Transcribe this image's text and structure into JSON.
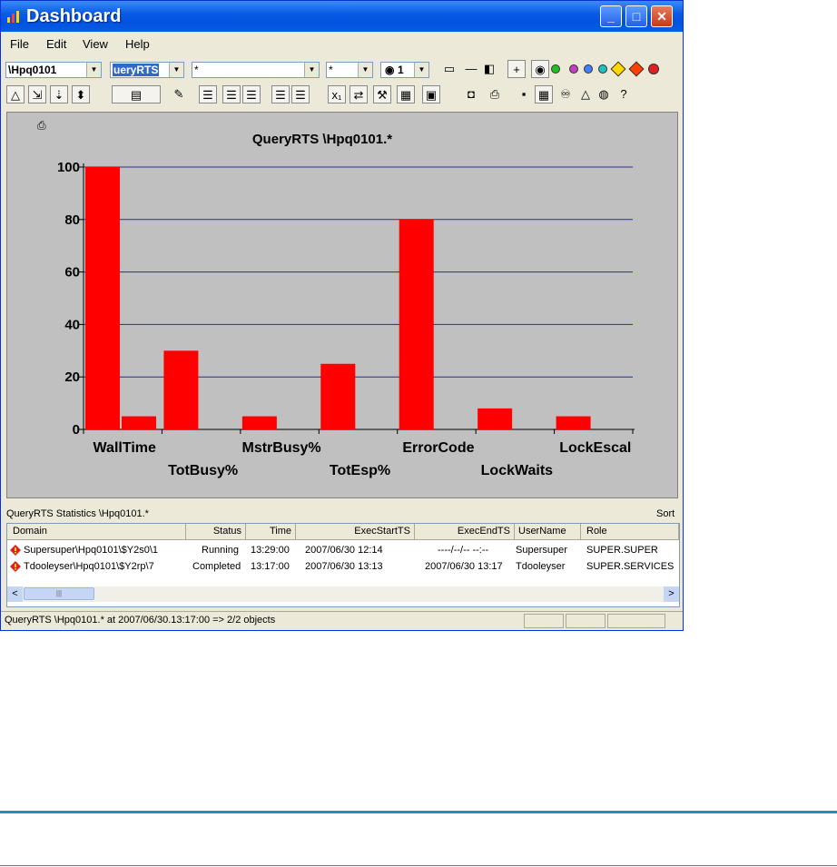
{
  "window": {
    "title": "Dashboard"
  },
  "menu": [
    "File",
    "Edit",
    "View",
    "Help"
  ],
  "toolbar": {
    "system": "\\Hpq0101",
    "query": "ueryRTS",
    "filter": "*",
    "filter2": "*",
    "count": "1"
  },
  "chart_data": {
    "type": "bar",
    "title": "QueryRTS \\Hpq0101.*",
    "categories": [
      "WallTime",
      "TotBusy%",
      "MstrBusy%",
      "TotEsp%",
      "ErrorCode",
      "LockWaits",
      "LockEscal"
    ],
    "bars": [
      {
        "category": "WallTime",
        "values": [
          100,
          5
        ]
      },
      {
        "category": "TotBusy%",
        "values": [
          30,
          0
        ]
      },
      {
        "category": "MstrBusy%",
        "values": [
          5,
          0
        ]
      },
      {
        "category": "TotEsp%",
        "values": [
          25,
          0
        ]
      },
      {
        "category": "ErrorCode",
        "values": [
          80,
          0
        ]
      },
      {
        "category": "LockWaits",
        "values": [
          8,
          0
        ]
      },
      {
        "category": "LockEscal",
        "values": [
          5,
          0
        ]
      }
    ],
    "ylim": [
      0,
      100
    ],
    "yticks": [
      0,
      20,
      40,
      60,
      80,
      100
    ],
    "grid": true,
    "bar_color": "#ff0000",
    "grid_color": "#2b2b9a"
  },
  "stats": {
    "label": "QueryRTS Statistics \\Hpq0101.*",
    "sort_label": "Sort",
    "columns": [
      "Domain",
      "Status",
      "Time",
      "ExecStartTS",
      "ExecEndTS",
      "UserName",
      "Role"
    ],
    "rows": [
      [
        "Supersuper\\Hpq0101\\$Y2s0\\1",
        "Running",
        "13:29:00",
        "2007/06/30 12:14",
        "----/--/-- --:--",
        "Supersuper",
        "SUPER.SUPER"
      ],
      [
        "Tdooleyser\\Hpq0101\\$Y2rp\\7",
        "Completed",
        "13:17:00",
        "2007/06/30 13:13",
        "2007/06/30 13:17",
        "Tdooleyser",
        "SUPER.SERVICES"
      ]
    ]
  },
  "status_bar": {
    "message": "QueryRTS \\Hpq0101.* at 2007/06/30.13:17:00 => 2/2 objects"
  },
  "colors": {
    "title_bar": "#0a5ce6",
    "rule": "#1a8fd0",
    "window_bg": "#ece9d8"
  }
}
